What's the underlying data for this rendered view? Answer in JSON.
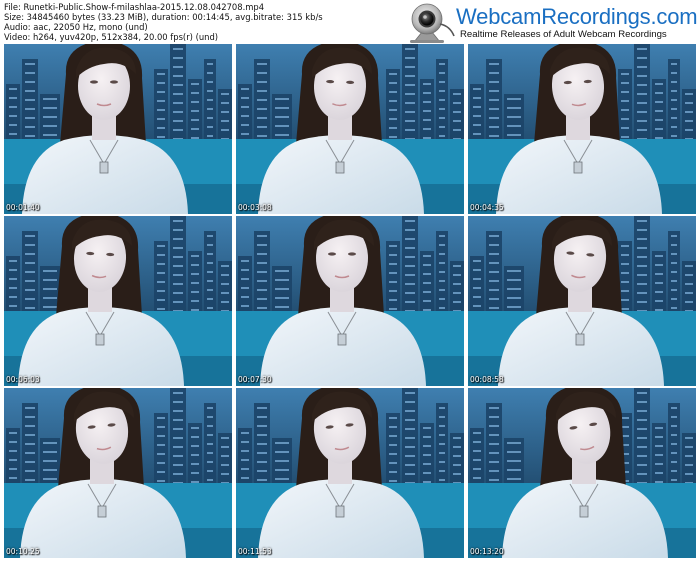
{
  "file_info": {
    "file_line": "File: Runetki-Public.Show-f-milashlaa-2015.12.08.042708.mp4",
    "size_line": "Size: 34845460 bytes (33.23 MiB), duration: 00:14:45, avg.bitrate: 315 kb/s",
    "audio_line": "Audio: aac, 22050 Hz, mono (und)",
    "video_line": "Video: h264, yuv420p, 512x384, 20.00 fps(r) (und)"
  },
  "logo": {
    "title": "WebcamRecordings.com",
    "tagline": "Realtime Releases of Adult Webcam Recordings",
    "icon": "webcam-icon",
    "color": "#1a6fc2"
  },
  "thumbnails": [
    {
      "timestamp": "00:01:40"
    },
    {
      "timestamp": "00:03:08"
    },
    {
      "timestamp": "00:04:35"
    },
    {
      "timestamp": "00:06:03"
    },
    {
      "timestamp": "00:07:30"
    },
    {
      "timestamp": "00:08:58"
    },
    {
      "timestamp": "00:10:25"
    },
    {
      "timestamp": "00:11:53"
    },
    {
      "timestamp": "00:13:20"
    }
  ]
}
